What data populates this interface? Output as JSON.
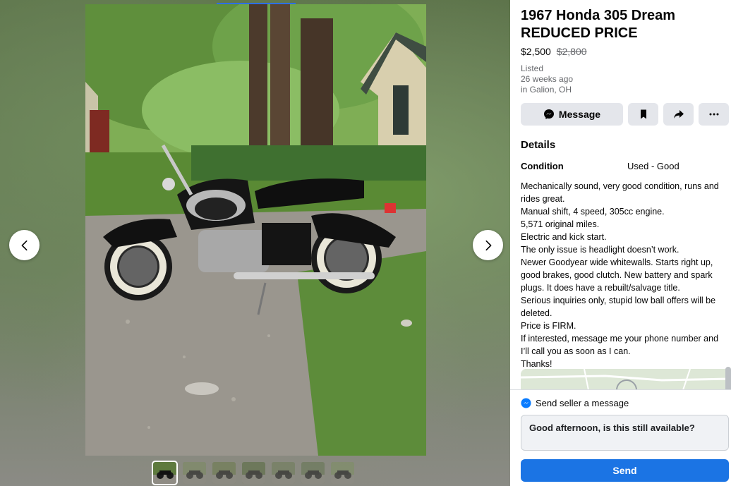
{
  "listing": {
    "title_line1": "1967 Honda 305 Dream",
    "title_line2": "REDUCED PRICE",
    "price": "$2,500",
    "original_price": "$2,800",
    "listed_label": "Listed",
    "listed_time": "26 weeks ago",
    "location": "in Galion, OH"
  },
  "actions": {
    "message_label": "Message",
    "save_icon": "bookmark-icon",
    "share_icon": "share-icon",
    "more_icon": "more-icon"
  },
  "details": {
    "heading": "Details",
    "condition_label": "Condition",
    "condition_value": "Used - Good",
    "description": [
      "Mechanically sound, very good condition, runs and rides great.",
      "Manual shift, 4 speed, 305cc engine.",
      "5,571 original miles.",
      "Electric and kick start.",
      "The only issue is headlight doesn’t work.",
      "Newer Goodyear wide whitewalls. Starts right up, good brakes, good clutch. New battery and spark plugs. It does have a rebuilt/salvage title.",
      "Serious inquiries only, stupid low ball offers will be deleted.",
      "Price is FIRM.",
      "If interested, message me your phone number and I’ll call you as soon as I can.",
      "Thanks!"
    ]
  },
  "compose": {
    "heading": "Send seller a message",
    "message_text": "Good afternoon, is this still available?",
    "send_label": "Send"
  },
  "viewer": {
    "photo_count": 7,
    "active_photo": 1,
    "prev_icon": "chevron-left-icon",
    "next_icon": "chevron-right-icon"
  },
  "colors": {
    "primary": "#1b74e4",
    "button_gray": "#e4e6eb",
    "muted_text": "#65676b",
    "messenger": "#0a7cff"
  }
}
